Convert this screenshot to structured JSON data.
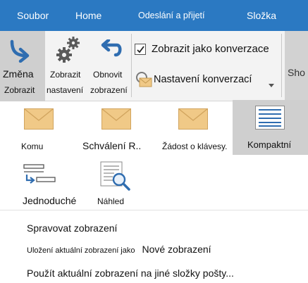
{
  "tabs": [
    {
      "label": "Soubor"
    },
    {
      "label": "Home"
    },
    {
      "label": "Odeslání a přijetí"
    },
    {
      "label": "Složka"
    }
  ],
  "ribbon": {
    "change_view": {
      "line1": "Změna",
      "line2": "Zobrazit",
      "icon": "change-view-arrow-icon"
    },
    "view_settings": {
      "line1": "Zobrazit",
      "line2": "nastavení",
      "icon": "gears-icon"
    },
    "reset_view": {
      "line1": "Obnovit",
      "line2": "zobrazení",
      "icon": "undo-arrow-icon"
    },
    "show_as_conversations": {
      "label": "Zobrazit jako konverzace",
      "checked": true
    },
    "conversation_settings": {
      "label": "Nastavení konverzací",
      "icon": "envelope-gear-icon"
    },
    "cutoff_label": "Sho"
  },
  "gallery": {
    "items": [
      {
        "label": "Komu",
        "icon": "envelope-icon"
      },
      {
        "label": "Schválení R..",
        "icon": "envelope-icon"
      },
      {
        "label": "Žádost o klávesy.",
        "icon": "envelope-icon"
      },
      {
        "label": "Kompaktní",
        "icon": "compact-list-icon",
        "selected": true
      },
      {
        "label": "Jednoduché",
        "icon": "single-line-icon"
      },
      {
        "label": "Náhled",
        "icon": "preview-magnifier-icon"
      }
    ]
  },
  "menu": {
    "manage_views": "Spravovat zobrazení",
    "save_current_prefix": "Uložení aktuální zobrazení jako",
    "save_current_suffix": "Nové zobrazení",
    "apply_current": "Použít aktuální zobrazení na jiné složky pošty..."
  },
  "colors": {
    "tab_bar": "#2b79c2",
    "ribbon_bg": "#f3f3f3",
    "selected_bg": "#cfcfcf",
    "envelope": "#f0c987",
    "icon_blue": "#2f6db0"
  }
}
